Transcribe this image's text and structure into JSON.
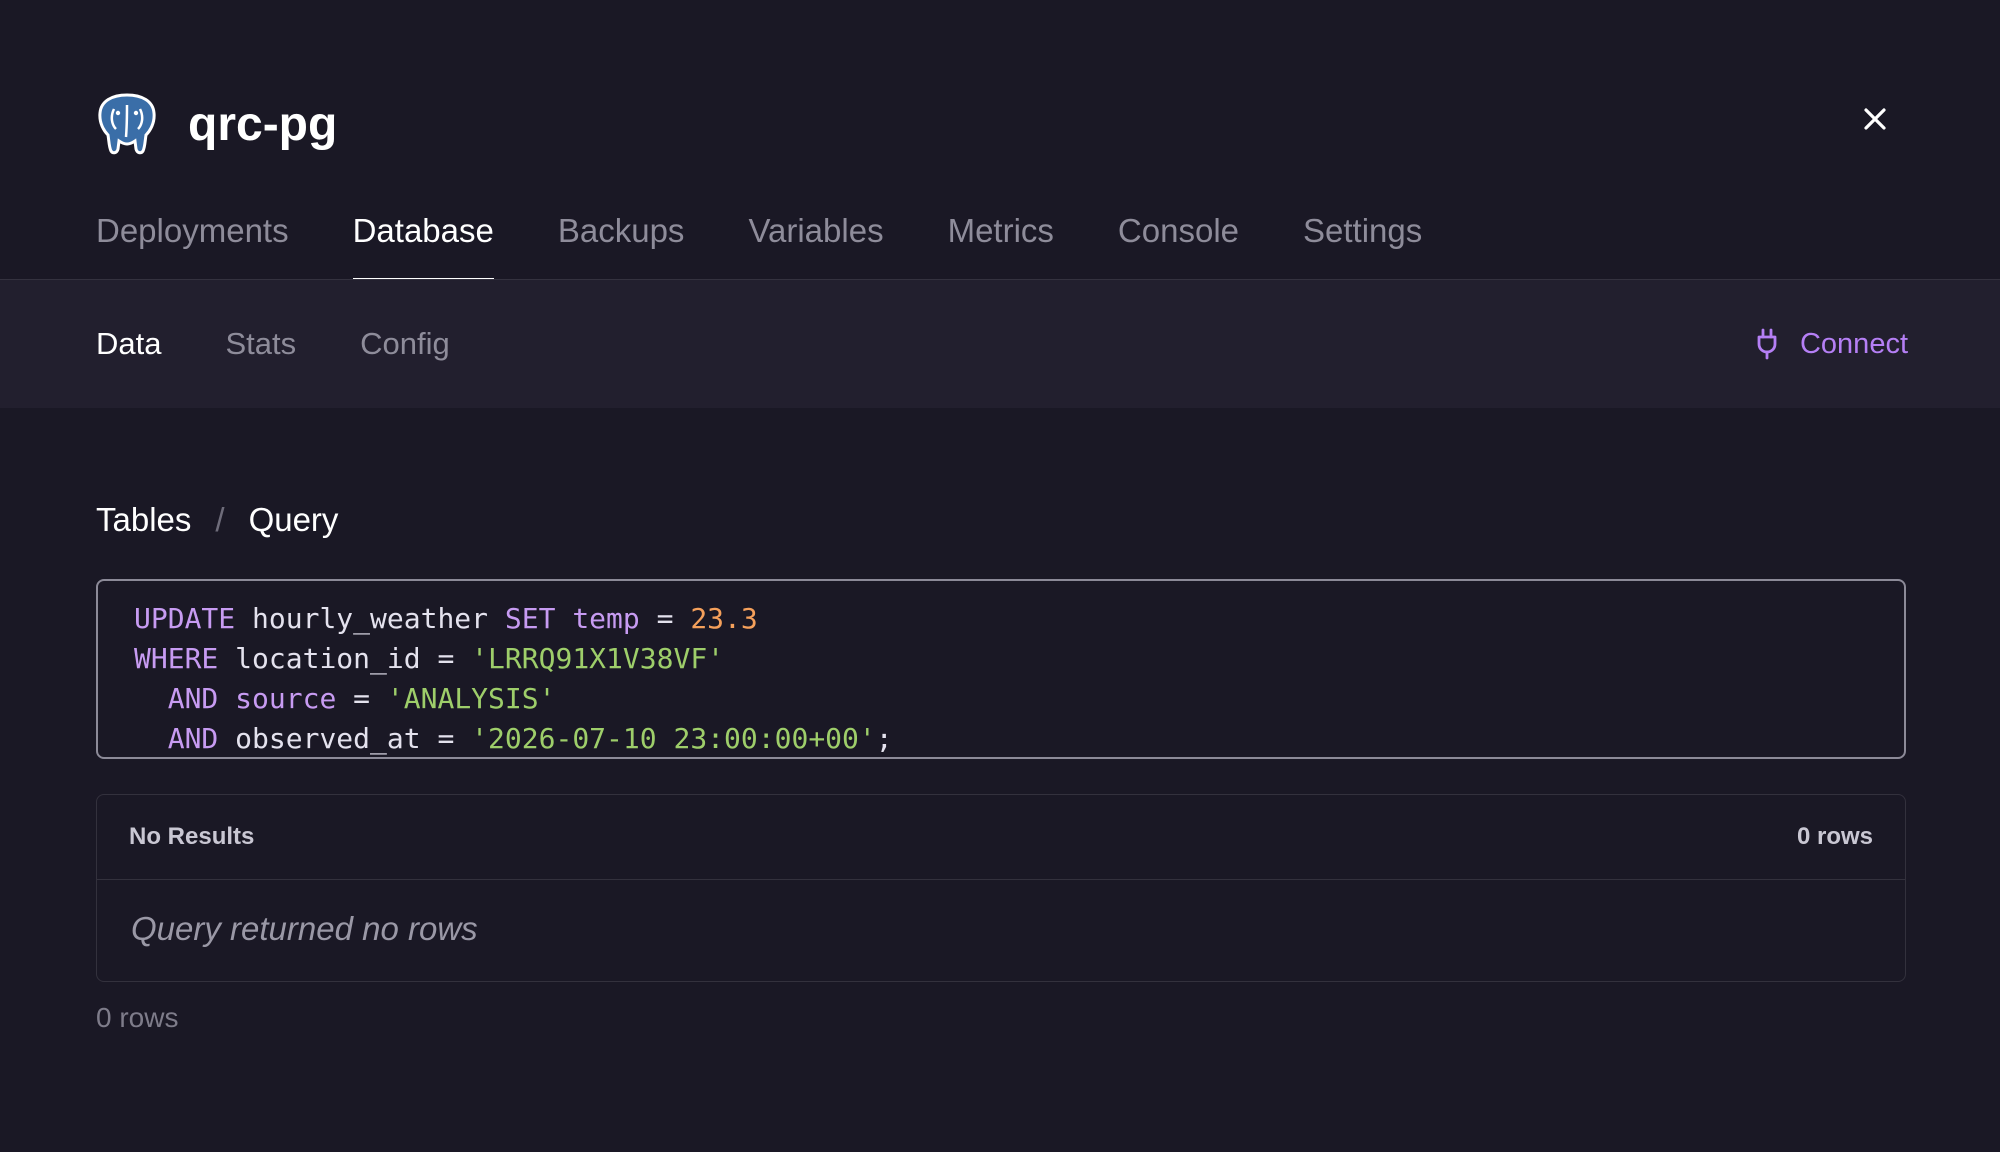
{
  "app": {
    "title": "qrc-pg",
    "logo_icon": "postgresql-elephant-icon"
  },
  "close": {
    "icon": "close-icon"
  },
  "tabs": [
    {
      "label": "Deployments",
      "active": false
    },
    {
      "label": "Database",
      "active": true
    },
    {
      "label": "Backups",
      "active": false
    },
    {
      "label": "Variables",
      "active": false
    },
    {
      "label": "Metrics",
      "active": false
    },
    {
      "label": "Console",
      "active": false
    },
    {
      "label": "Settings",
      "active": false
    }
  ],
  "subtabs": [
    {
      "label": "Data",
      "active": true
    },
    {
      "label": "Stats",
      "active": false
    },
    {
      "label": "Config",
      "active": false
    }
  ],
  "connect": {
    "label": "Connect",
    "icon": "plug-icon",
    "color": "#b57ff5"
  },
  "breadcrumb": {
    "tables": "Tables",
    "separator": "/",
    "query": "Query"
  },
  "query": {
    "lines": [
      [
        {
          "t": "UPDATE",
          "c": "kw"
        },
        {
          "t": " hourly_weather ",
          "c": ""
        },
        {
          "t": "SET",
          "c": "kw"
        },
        {
          "t": " ",
          "c": ""
        },
        {
          "t": "temp",
          "c": "kw"
        },
        {
          "t": " = ",
          "c": ""
        },
        {
          "t": "23.3",
          "c": "num"
        }
      ],
      [
        {
          "t": "WHERE",
          "c": "kw"
        },
        {
          "t": " location_id = ",
          "c": ""
        },
        {
          "t": "'LRRQ91X1V38VF'",
          "c": "str"
        }
      ],
      [
        {
          "t": "  ",
          "c": ""
        },
        {
          "t": "AND",
          "c": "kw"
        },
        {
          "t": " ",
          "c": ""
        },
        {
          "t": "source",
          "c": "kw"
        },
        {
          "t": " = ",
          "c": ""
        },
        {
          "t": "'ANALYSIS'",
          "c": "str"
        }
      ],
      [
        {
          "t": "  ",
          "c": ""
        },
        {
          "t": "AND",
          "c": "kw"
        },
        {
          "t": " observed_at = ",
          "c": ""
        },
        {
          "t": "'2026-07-10 23:00:00+00'",
          "c": "str"
        },
        {
          "t": ";",
          "c": ""
        }
      ]
    ]
  },
  "results": {
    "title": "No Results",
    "count": "0 rows",
    "empty_message": "Query returned no rows"
  },
  "footer": {
    "count": "0 rows"
  }
}
